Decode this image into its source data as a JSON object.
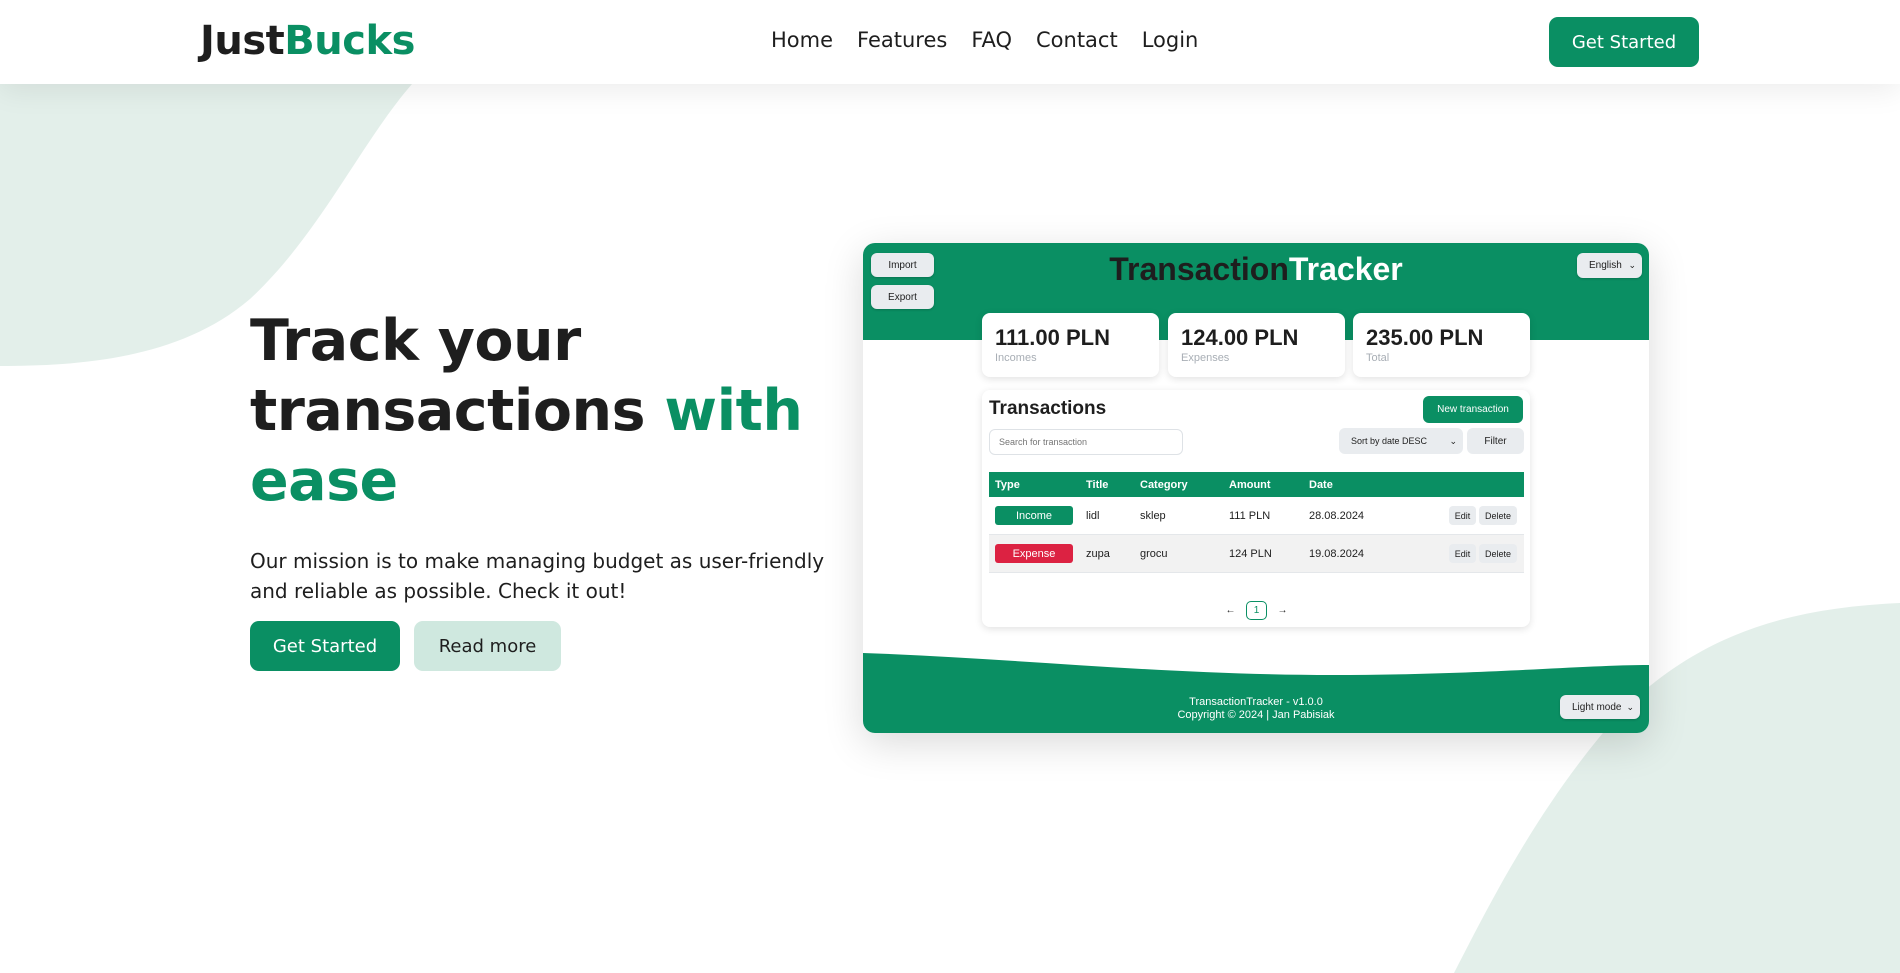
{
  "brand": {
    "name_part1": "Just",
    "name_part2": "Bucks"
  },
  "nav": {
    "links": [
      "Home",
      "Features",
      "FAQ",
      "Contact",
      "Login"
    ],
    "cta_label": "Get Started"
  },
  "hero": {
    "title_line1": "Track your",
    "title_line2": "transactions",
    "title_accent1": "with",
    "title_accent2": "ease",
    "subtitle": "Our mission is to make managing budget as user-friendly and reliable as possible. Check it out!",
    "primary_label": "Get Started",
    "secondary_label": "Read more"
  },
  "app": {
    "title_part1": "Transaction",
    "title_part2": "Tracker",
    "import_label": "Import",
    "export_label": "Export",
    "language": "English",
    "stats": [
      {
        "value": "111.00 PLN",
        "label": "Incomes"
      },
      {
        "value": "124.00 PLN",
        "label": "Expenses"
      },
      {
        "value": "235.00 PLN",
        "label": "Total"
      }
    ],
    "transactions": {
      "heading": "Transactions",
      "new_label": "New transaction",
      "search_placeholder": "Search for transaction",
      "sort_value": "Sort by date DESC",
      "filter_label": "Filter",
      "columns": [
        "Type",
        "Title",
        "Category",
        "Amount",
        "Date"
      ],
      "rows": [
        {
          "type": "Income",
          "title": "lidl",
          "category": "sklep",
          "amount": "111 PLN",
          "date": "28.08.2024",
          "edit": "Edit",
          "delete": "Delete"
        },
        {
          "type": "Expense",
          "title": "zupa",
          "category": "grocu",
          "amount": "124 PLN",
          "date": "19.08.2024",
          "edit": "Edit",
          "delete": "Delete"
        }
      ],
      "pagination": {
        "prev_icon": "←",
        "current_page": "1",
        "next_icon": "→"
      }
    },
    "footer": {
      "version": "TransactionTracker - v1.0.0",
      "copyright": "Copyright © 2024 | Jan Pabisiak",
      "theme": "Light mode"
    }
  },
  "colors": {
    "accent": "#0a8f63",
    "expense": "#dc2242",
    "accent_light": "#cfe8df",
    "blob": "#e3efea"
  }
}
